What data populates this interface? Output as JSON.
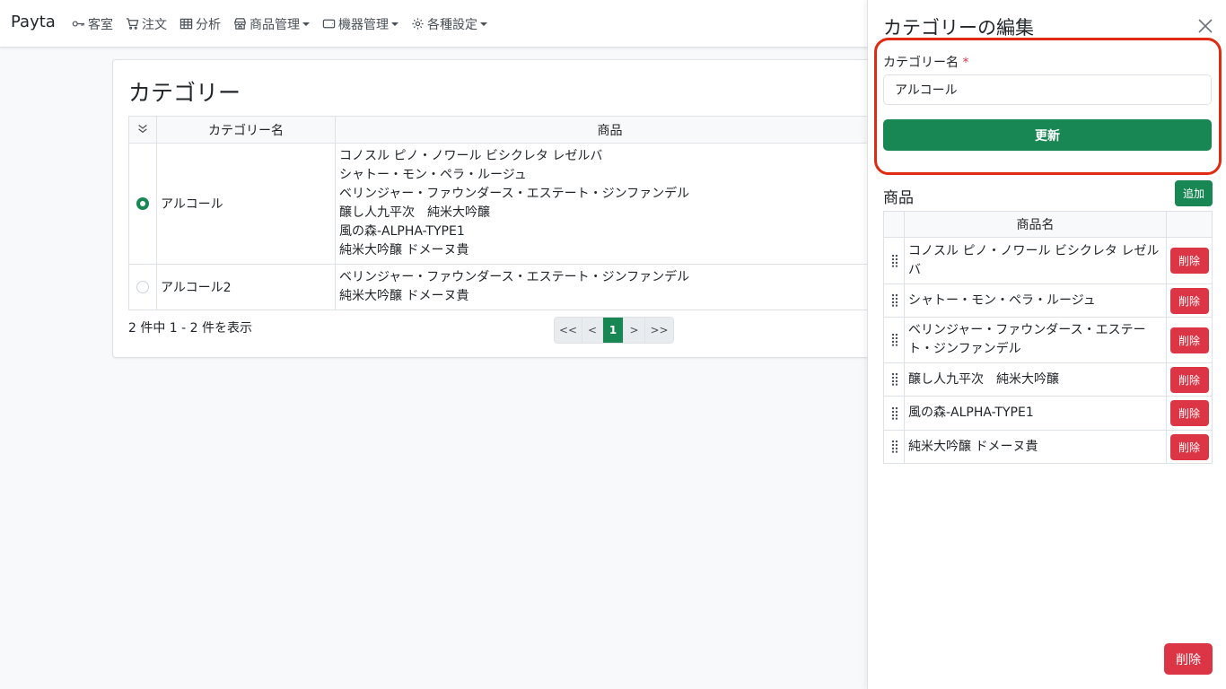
{
  "navbar": {
    "brand": "Payta",
    "items": [
      {
        "label": "客室",
        "icon": "key-icon",
        "dropdown": false
      },
      {
        "label": "注文",
        "icon": "cart-icon",
        "dropdown": false
      },
      {
        "label": "分析",
        "icon": "table-icon",
        "dropdown": false
      },
      {
        "label": "商品管理",
        "icon": "shop-icon",
        "dropdown": true
      },
      {
        "label": "機器管理",
        "icon": "device-icon",
        "dropdown": true
      },
      {
        "label": "各種設定",
        "icon": "gear-icon",
        "dropdown": true
      }
    ]
  },
  "main": {
    "title": "カテゴリー",
    "table": {
      "headers": {
        "name": "カテゴリー名",
        "products": "商品"
      },
      "rows": [
        {
          "selected": true,
          "name": "アルコール",
          "products": [
            "コノスル ピノ・ノワール ビシクレタ レゼルバ",
            "シャトー・モン・ペラ・ルージュ",
            "ベリンジャー・ファウンダース・エステート・ジンファンデル",
            "醸し人九平次　純米大吟醸",
            "風の森-ALPHA-TYPE1",
            "純米大吟醸 ドメーヌ貴"
          ]
        },
        {
          "selected": false,
          "name": "アルコール2",
          "products": [
            "ベリンジャー・ファウンダース・エステート・ジンファンデル",
            "純米大吟醸 ドメーヌ貴"
          ]
        }
      ]
    },
    "count_text": "2 件中 1 - 2 件を表示",
    "pagination": {
      "first": "<<",
      "prev": "<",
      "current": "1",
      "next": ">",
      "last": ">>"
    }
  },
  "panel": {
    "title": "カテゴリーの編集",
    "field_label": "カテゴリー名",
    "required_mark": "*",
    "field_value": "アルコール",
    "update_label": "更新",
    "products_title": "商品",
    "add_label": "追加",
    "products_header": "商品名",
    "products": [
      "コノスル ピノ・ノワール ビシクレタ レゼルバ",
      "シャトー・モン・ペラ・ルージュ",
      "ベリンジャー・ファウンダース・エステート・ジンファンデル",
      "醸し人九平次　純米大吟醸",
      "風の森-ALPHA-TYPE1",
      "純米大吟醸 ドメーヌ貴"
    ],
    "row_delete_label": "削除",
    "delete_label": "削除"
  },
  "colors": {
    "primary": "#198754",
    "danger": "#dc3545",
    "highlight": "#e02a12"
  }
}
